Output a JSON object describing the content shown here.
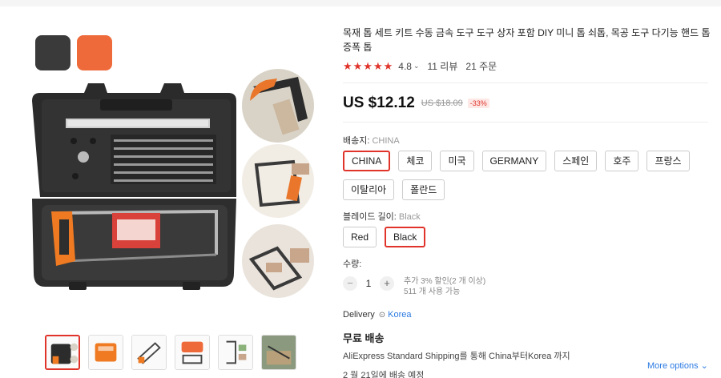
{
  "product": {
    "title": "목재 톱 세트 키트 수동 금속 도구 도구 상자 포함 DIY 미니 톱 쇠톱, 목공 도구 다기능 핸드 톱 증폭 톱",
    "rating": "4.8",
    "reviews": "11 리뷰",
    "orders": "21 주문",
    "price": "US $12.12",
    "old_price": "US $18.09",
    "discount": "-33%"
  },
  "ships_from": {
    "label": "배송지:",
    "selected": "CHINA",
    "options": [
      "CHINA",
      "체코",
      "미국",
      "GERMANY",
      "스페인",
      "호주",
      "프랑스",
      "이탈리아",
      "폴란드"
    ]
  },
  "blade_length": {
    "label": "블레이드 길이:",
    "selected": "Black",
    "options": [
      "Red",
      "Black"
    ]
  },
  "quantity": {
    "label": "수량:",
    "value": "1",
    "minus": "−",
    "plus": "+",
    "extra_discount": "추가 3% 할인(2 개 이상)",
    "available": "511 개 사용 가능"
  },
  "delivery": {
    "label": "Delivery",
    "country": "Korea",
    "free_shipping": "무료 배송",
    "method": "AliExpress Standard Shipping를 통해 China부터Korea 까지",
    "date": "2 월 21일에 배송 예정",
    "more_options": "More options"
  },
  "colors": {
    "accent": "#e0342b",
    "swatch_black": "#3a3a3a",
    "swatch_orange": "#ef6a3a",
    "link": "#2a7ae2"
  },
  "icons": [
    "star-icon",
    "chevron-down-icon",
    "location-pin-icon"
  ]
}
